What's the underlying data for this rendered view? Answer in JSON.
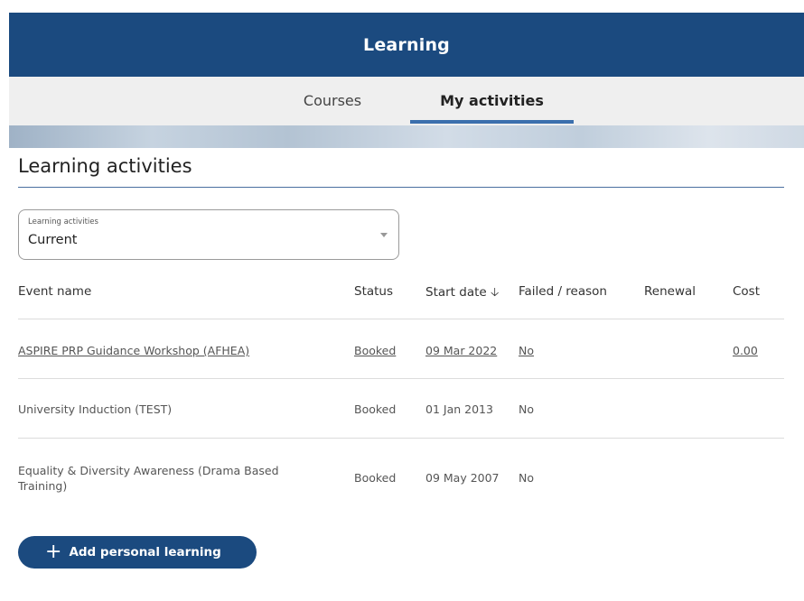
{
  "header": {
    "title": "Learning"
  },
  "tabs": [
    {
      "label": "Courses"
    },
    {
      "label": "My activities"
    }
  ],
  "section": {
    "title": "Learning activities"
  },
  "filter": {
    "label": "Learning activities",
    "value": "Current"
  },
  "table": {
    "columns": [
      "Event name",
      "Status",
      "Start date",
      "Failed / reason",
      "Renewal",
      "Cost"
    ],
    "sort_icon": "arrow-down-icon",
    "rows": [
      {
        "event": "ASPIRE PRP Guidance Workshop (AFHEA)",
        "status": "Booked",
        "start": "09 Mar 2022",
        "failed": "No",
        "renewal": "",
        "cost": "0.00"
      },
      {
        "event": "University Induction (TEST)",
        "status": "Booked",
        "start": "01 Jan 2013",
        "failed": "No",
        "renewal": "",
        "cost": ""
      },
      {
        "event": "Equality & Diversity Awareness (Drama Based Training)",
        "status": "Booked",
        "start": "09 May 2007",
        "failed": "No",
        "renewal": "",
        "cost": ""
      }
    ]
  },
  "actions": {
    "add_label": "Add personal learning",
    "add_icon": "plus-icon"
  },
  "colors": {
    "brand": "#1b4a7f",
    "accent": "#3b6fad"
  }
}
